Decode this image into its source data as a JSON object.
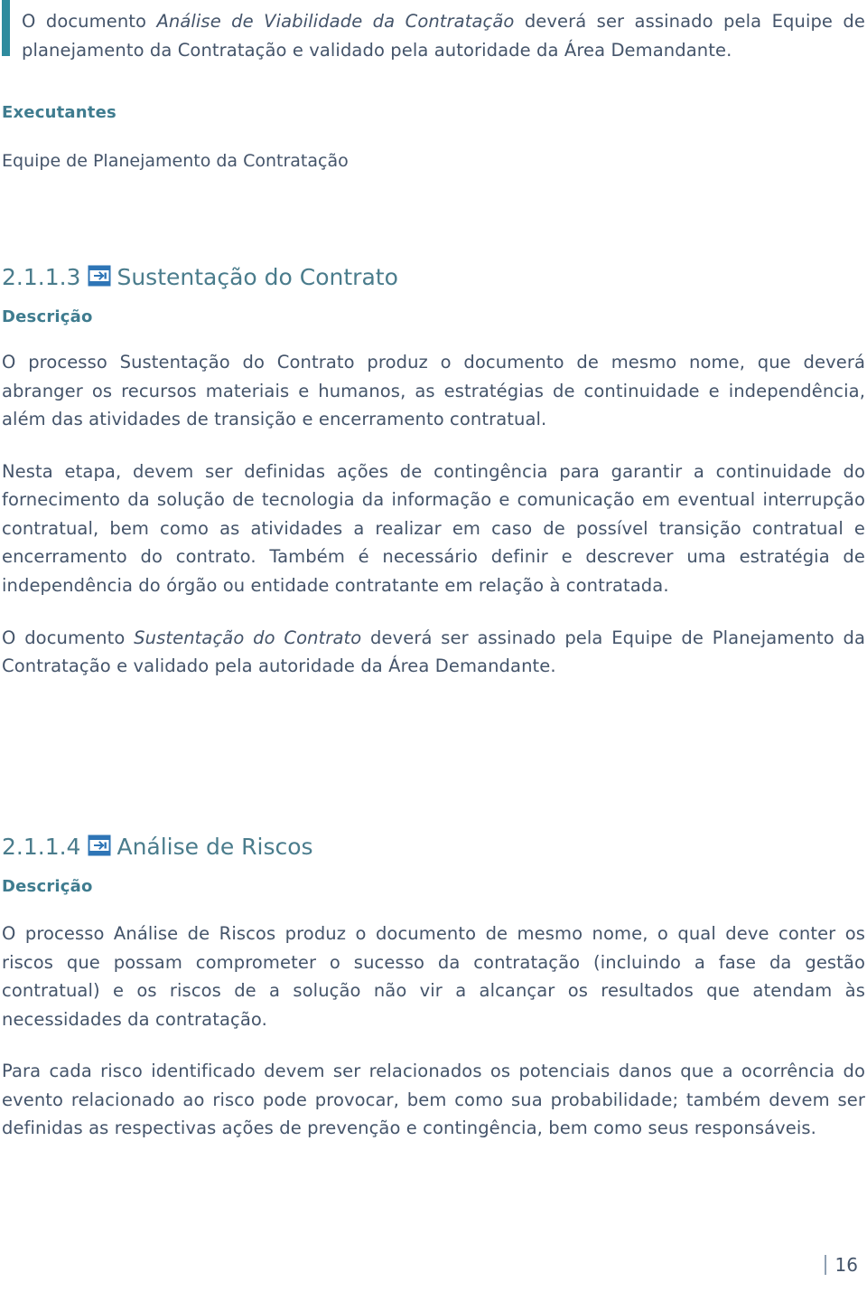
{
  "document": {
    "language": "pt-BR",
    "page_number": "16",
    "colors": {
      "body_text": "#44546a",
      "heading_teal": "#4a7c8c",
      "subheading_teal": "#3f7c8f",
      "accent_bar": "#2e8b9e",
      "icon_blue": "#2e75b6"
    }
  },
  "top_callout": {
    "text_parts": {
      "before": "O documento ",
      "italic": "Análise de Viabilidade da Contratação",
      "after": " deverá ser assinado pela Equipe de planejamento da Contratação e validado pela autoridade da Área Demandante."
    },
    "full_text": "O documento Análise de Viabilidade da Contratação deverá ser assinado pela Equipe de planejamento da Contratação e validado pela autoridade da Área Demandante."
  },
  "executantes_section": {
    "heading": "Executantes",
    "body": "Equipe de Planejamento da Contratação"
  },
  "sections": [
    {
      "number": "2.1.1.3",
      "icon": "document-form-icon",
      "title": "Sustentação do Contrato",
      "subheading": "Descrição",
      "paragraphs": [
        {
          "id": "p1",
          "text": "O processo Sustentação do Contrato produz o documento de mesmo nome, que deverá abranger os recursos materiais e humanos, as estratégias de continuidade e independência, além das atividades de transição e encerramento contratual."
        },
        {
          "id": "p2",
          "text": "Nesta etapa, devem ser definidas ações de contingência para garantir a continuidade do fornecimento da solução de tecnologia da informação e comunicação em eventual interrupção contratual, bem como as atividades a realizar em caso de possível transição contratual e encerramento do contrato. Também é necessário definir e descrever uma estratégia de independência do órgão ou entidade contratante em relação à contratada."
        },
        {
          "id": "p3",
          "before": "O documento ",
          "italic": "Sustentação do Contrato",
          "after": " deverá ser assinado pela Equipe de Planejamento da Contratação e validado pela autoridade da Área Demandante.",
          "text": "O documento Sustentação do Contrato deverá ser assinado pela Equipe de Planejamento da Contratação e validado pela autoridade da Área Demandante."
        }
      ]
    },
    {
      "number": "2.1.1.4",
      "icon": "document-form-icon",
      "title": "Análise de Riscos",
      "subheading": "Descrição",
      "paragraphs": [
        {
          "id": "p1",
          "text": "O processo Análise de Riscos produz o documento de mesmo nome, o qual deve conter os riscos que possam comprometer o sucesso da contratação (incluindo a fase da gestão contratual) e os riscos de a solução não vir a alcançar os resultados que atendam às necessidades da contratação."
        },
        {
          "id": "p2",
          "text": "Para cada risco identificado devem ser relacionados os potenciais danos que a ocorrência do evento relacionado ao risco pode provocar, bem como sua probabilidade; também devem ser definidas as respectivas ações de prevenção e contingência, bem como seus responsáveis."
        }
      ]
    }
  ]
}
